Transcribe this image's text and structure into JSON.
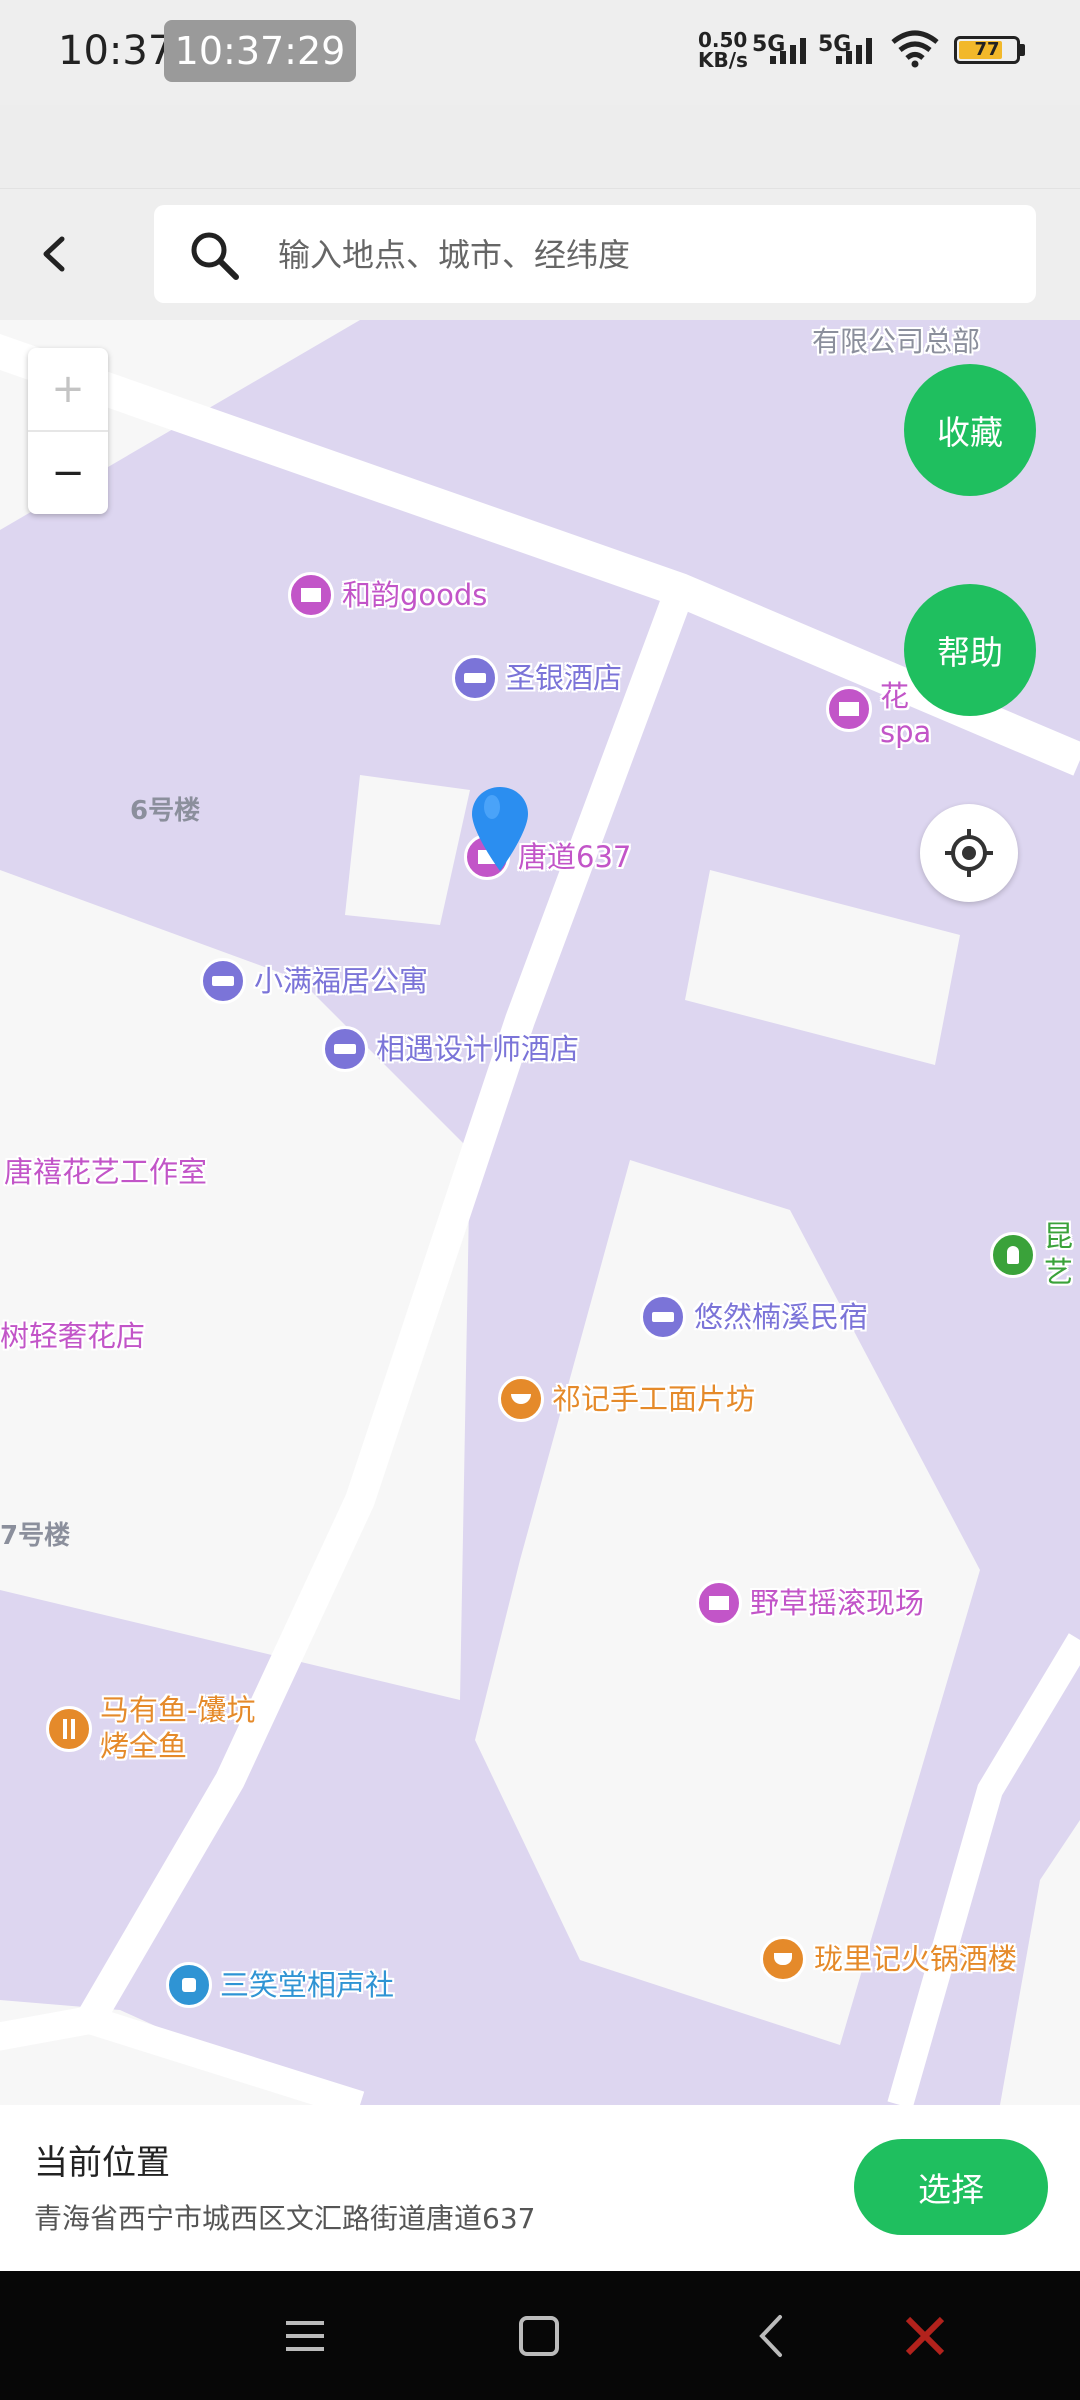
{
  "status_bar": {
    "time": "10:37",
    "time_chip": "10:37:29",
    "net_speed_value": "0.50",
    "net_speed_unit": "KB/s",
    "sim1": "5G",
    "sim2": "5G",
    "battery": "77"
  },
  "search": {
    "placeholder": "输入地点、城市、经纬度",
    "value": ""
  },
  "map": {
    "zoom_in": "+",
    "zoom_out": "−",
    "favorite_label": "收藏",
    "help_label": "帮助",
    "top_label": "有限公司总部",
    "buildings": [
      "6号楼",
      "7号楼"
    ],
    "pois": [
      {
        "name": "和韵goods",
        "category": "shop",
        "icon": "shop-icon"
      },
      {
        "name": "圣银酒店",
        "category": "hotel",
        "icon": "bed-icon"
      },
      {
        "name": "花",
        "name_line2": "spa",
        "category": "shop",
        "icon": "shop-icon"
      },
      {
        "name": "唐道637",
        "category": "shop",
        "icon": "shop-icon"
      },
      {
        "name": "小满福居公寓",
        "category": "hotel",
        "icon": "bed-icon"
      },
      {
        "name": "相遇设计师酒店",
        "category": "hotel",
        "icon": "bed-icon"
      },
      {
        "name": "唐禧花艺工作室",
        "category": "shop-text",
        "icon": ""
      },
      {
        "name": "昆",
        "name_line2": "艺",
        "category": "park",
        "icon": "tree-icon"
      },
      {
        "name": "悠然楠溪民宿",
        "category": "hotel",
        "icon": "bed-icon"
      },
      {
        "name": "树轻奢花店",
        "category": "shop-text",
        "icon": ""
      },
      {
        "name": "祁记手工面片坊",
        "category": "food",
        "icon": "bowl-icon"
      },
      {
        "name": "野草摇滚现场",
        "category": "shop",
        "icon": "shop-icon"
      },
      {
        "name": "马有鱼-馕坑",
        "name_line2": "烤全鱼",
        "category": "food",
        "icon": "fork-knife-icon"
      },
      {
        "name": "珑里记火锅酒楼",
        "category": "food",
        "icon": "hotpot-icon"
      },
      {
        "name": "三笑堂相声社",
        "category": "culture",
        "icon": "culture-icon"
      }
    ],
    "colors": {
      "land": "#ddd6f0",
      "road": "#ffffff",
      "block": "#f7f7f7",
      "hotel": "#7b74d8",
      "shop": "#c255c8",
      "food": "#e58a2a",
      "park": "#3aa23a",
      "culture": "#2f94d4",
      "accent": "#1fbf5f"
    },
    "marker_color": "#2b8ef0"
  },
  "location_panel": {
    "title": "当前位置",
    "address": "青海省西宁市城西区文汇路街道唐道637",
    "select_label": "选择"
  }
}
